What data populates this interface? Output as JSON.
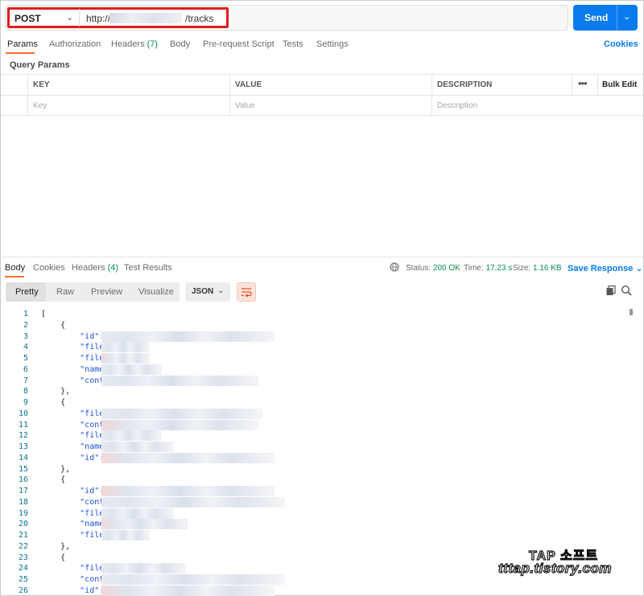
{
  "request": {
    "method": "POST",
    "url_prefix": "http://",
    "url_suffix": "/tracks",
    "send_label": "Send"
  },
  "request_tabs": [
    {
      "label": "Params",
      "active": true
    },
    {
      "label": "Authorization"
    },
    {
      "label": "Headers",
      "count": "(7)"
    },
    {
      "label": "Body"
    },
    {
      "label": "Pre-request Script"
    },
    {
      "label": "Tests"
    },
    {
      "label": "Settings"
    }
  ],
  "cookies_label": "Cookies",
  "query_params": {
    "title": "Query Params",
    "headers": [
      "KEY",
      "VALUE",
      "DESCRIPTION"
    ],
    "placeholders": [
      "Key",
      "Value",
      "Description"
    ],
    "bulk_edit": "Bulk Edit",
    "more": "•••"
  },
  "response_tabs": [
    {
      "label": "Body",
      "active": true
    },
    {
      "label": "Cookies"
    },
    {
      "label": "Headers",
      "count": "(4)"
    },
    {
      "label": "Test Results"
    }
  ],
  "status": {
    "status_label": "Status:",
    "status_value": "200 OK",
    "time_label": "Time:",
    "time_value": "17.23 s",
    "size_label": "Size:",
    "size_value": "1.16 KB"
  },
  "save_response": "Save Response",
  "view_modes": [
    "Pretty",
    "Raw",
    "Preview",
    "Visualize"
  ],
  "format": "JSON",
  "code_lines": [
    {
      "n": "1",
      "text": "["
    },
    {
      "n": "2",
      "text": "    {"
    },
    {
      "n": "3",
      "text": "        \"id\": "
    },
    {
      "n": "4",
      "text": "        \"fileN"
    },
    {
      "n": "5",
      "text": "        \"fileT"
    },
    {
      "n": "6",
      "text": "        \"name\""
    },
    {
      "n": "7",
      "text": "        \"conte"
    },
    {
      "n": "8",
      "text": "    },"
    },
    {
      "n": "9",
      "text": "    {"
    },
    {
      "n": "10",
      "text": "        \"fileN"
    },
    {
      "n": "11",
      "text": "        \"conte"
    },
    {
      "n": "12",
      "text": "        \"fileT"
    },
    {
      "n": "13",
      "text": "        \"name\""
    },
    {
      "n": "14",
      "text": "        \"id\": "
    },
    {
      "n": "15",
      "text": "    },"
    },
    {
      "n": "16",
      "text": "    {"
    },
    {
      "n": "17",
      "text": "        \"id\": "
    },
    {
      "n": "18",
      "text": "        \"conte"
    },
    {
      "n": "19",
      "text": "        \"fileN"
    },
    {
      "n": "20",
      "text": "        \"name\""
    },
    {
      "n": "21",
      "text": "        \"fileT"
    },
    {
      "n": "22",
      "text": "    },"
    },
    {
      "n": "23",
      "text": "    {"
    },
    {
      "n": "24",
      "text": "        \"fileN"
    },
    {
      "n": "25",
      "text": "        \"conte"
    },
    {
      "n": "26",
      "text": "        \"id\": "
    }
  ],
  "watermark": {
    "line1": "TAP 소프트",
    "line2": "tttap.tistory.com"
  },
  "colors": {
    "accent_blue": "#097bed",
    "tab_orange": "#ff6c37",
    "status_green": "#0a8f4c",
    "highlight_red": "#e11d1d"
  }
}
